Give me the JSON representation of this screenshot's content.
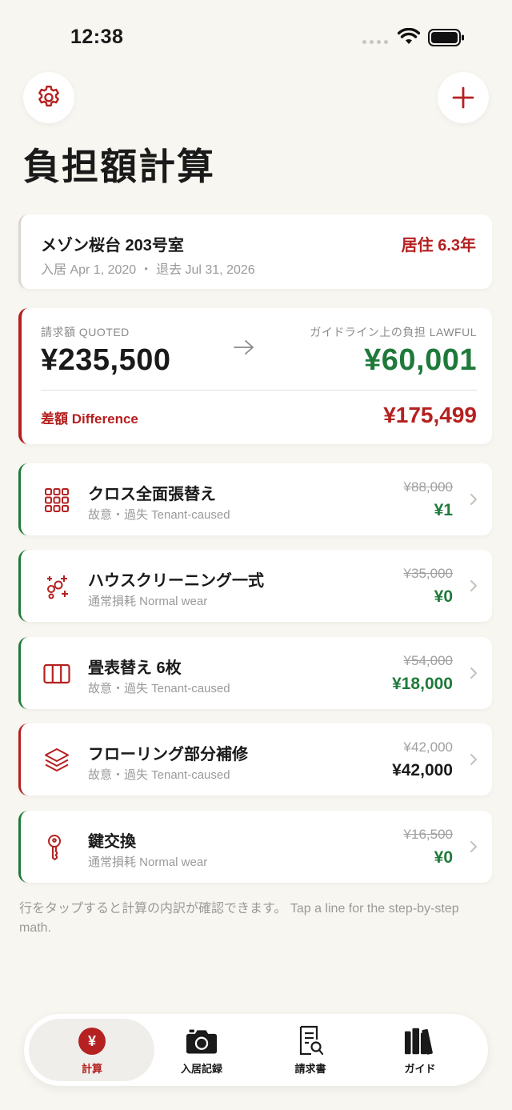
{
  "status_bar": {
    "time": "12:38"
  },
  "page": {
    "title": "負担額計算"
  },
  "property": {
    "name": "メゾン桜台 203号室",
    "dates": "入居 Apr 1, 2020 ・ 退去 Jul 31, 2026",
    "tenure": "居住 6.3年"
  },
  "summary": {
    "quoted_label": "請求額 QUOTED",
    "quoted_value": "¥235,500",
    "lawful_label": "ガイドライン上の負担 LAWFUL",
    "lawful_value": "¥60,001",
    "difference_label": "差額 Difference",
    "difference_value": "¥175,499"
  },
  "items": [
    {
      "name": "クロス全面張替え",
      "category": "故意・過失 Tenant-caused",
      "original": "¥88,000",
      "amount": "¥1",
      "icon": "grid-icon"
    },
    {
      "name": "ハウスクリーニング一式",
      "category": "通常損耗 Normal wear",
      "original": "¥35,000",
      "amount": "¥0",
      "icon": "sparkles-icon"
    },
    {
      "name": "畳表替え 6枚",
      "category": "故意・過失 Tenant-caused",
      "original": "¥54,000",
      "amount": "¥18,000",
      "icon": "tatami-icon"
    },
    {
      "name": "フローリング部分補修",
      "category": "故意・過失 Tenant-caused",
      "original": "¥42,000",
      "amount": "¥42,000",
      "icon": "layers-icon"
    },
    {
      "name": "鍵交換",
      "category": "通常損耗 Normal wear",
      "original": "¥16,500",
      "amount": "¥0",
      "icon": "key-icon"
    }
  ],
  "footnote": "行をタップすると計算の内訳が確認できます。 Tap a line for the step-by-step math.",
  "tabs": [
    {
      "label": "計算",
      "icon": "yen-icon",
      "active": true
    },
    {
      "label": "入居記録",
      "icon": "camera-icon",
      "active": false
    },
    {
      "label": "請求書",
      "icon": "document-search-icon",
      "active": false
    },
    {
      "label": "ガイド",
      "icon": "books-icon",
      "active": false
    }
  ],
  "colors": {
    "accent_red": "#b52020",
    "lawful_green": "#1f7a3a",
    "background": "#f8f6f0"
  }
}
